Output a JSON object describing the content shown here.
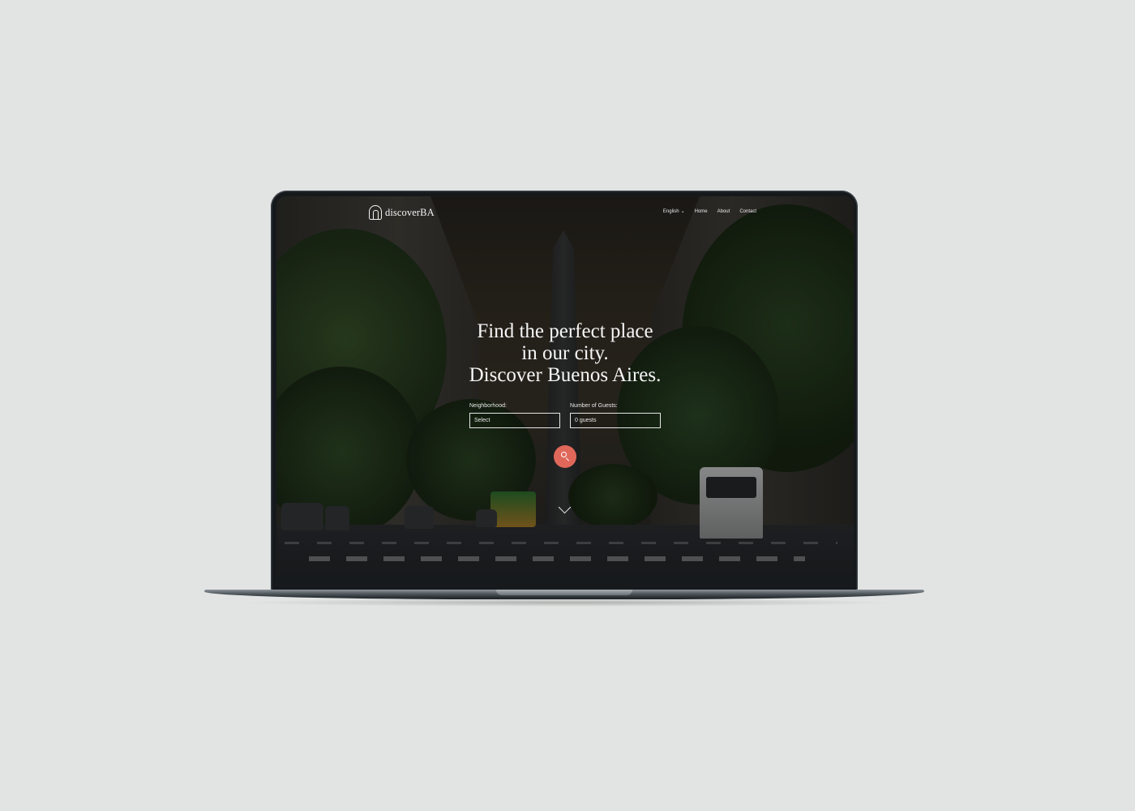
{
  "site": {
    "logo_text": "discoverBA"
  },
  "nav": {
    "language": "English",
    "items": [
      "Home",
      "About",
      "Contact"
    ]
  },
  "hero": {
    "line1": "Find the perfect place",
    "line2": "in our city.",
    "line3": "Discover Buenos Aires."
  },
  "search": {
    "neighborhood_label": "Neighborhood:",
    "neighborhood_value": "Select",
    "guests_label": "Number of Guests:",
    "guests_value": "0 guests",
    "button_icon": "search-icon"
  },
  "colors": {
    "accent": "#e0685a",
    "text": "#f6f6f6"
  }
}
